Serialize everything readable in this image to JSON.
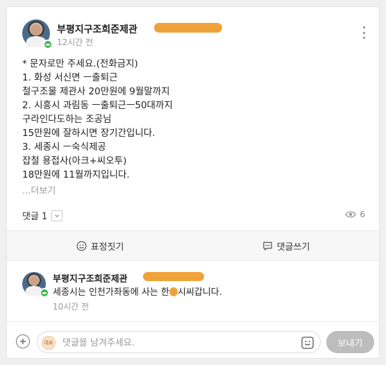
{
  "post": {
    "author": "부평지구조희준제관",
    "time": "12시간 전",
    "lines": [
      "* 문자로만 주세요.(전화금지)",
      "1. 화성 서신면 ㅡ출퇴근",
      "철구조물 제관사 20만원에 9월말까지",
      "2. 시흥시 과림동 ㅡ출퇴근ㅡ50대까지",
      "구라인다도하는 조공님",
      "15만원에 잘하시면 장기간입니다.",
      "3. 세종시 ㅡ숙식제공",
      "잡철 용접사(아크+씨오투)",
      "18만원에 11월까지입니다."
    ],
    "more_label": "...더보기",
    "comment_count_label": "댓글 1",
    "view_count": "6"
  },
  "actions": {
    "react_label": "표정짓기",
    "comment_label": "댓글쓰기"
  },
  "comment": {
    "author": "부평지구조희준제관",
    "text_before": "세종시는 인천가좌동에 사는 한",
    "text_after": "시씨갑니다.",
    "time": "10시간 전"
  },
  "footer": {
    "placeholder": "댓글을 남겨주세요.",
    "send_label": "보내기",
    "avatar_text": "대표"
  },
  "colors": {
    "redaction": "#f0a23a",
    "badge": "#3bb54a",
    "send_button": "#bdbdbd"
  },
  "icons": [
    "more-vertical-icon",
    "chevron-down-icon",
    "eye-icon",
    "smile-icon",
    "chat-icon",
    "plus-icon",
    "emoji-icon"
  ]
}
